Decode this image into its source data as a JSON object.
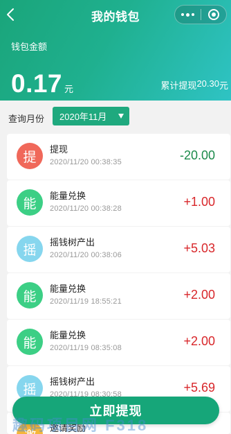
{
  "nav": {
    "title": "我的钱包",
    "back_icon": "chevron-left-icon",
    "more_icon": "more-dots-icon",
    "close_icon": "target-circle-icon"
  },
  "header": {
    "wallet_label": "钱包金额",
    "balance": "0.17",
    "balance_unit": "元",
    "total_withdraw_label": "累计提现",
    "total_withdraw_value": "20.30",
    "total_withdraw_unit": "元"
  },
  "filter": {
    "label": "查询月份",
    "month": "2020年11月"
  },
  "records": [
    {
      "icon_char": "提",
      "icon_color": "#f0685a",
      "title": "提现",
      "time": "2020/11/20 00:38:35",
      "amount": "-20.00",
      "amount_color": "#1b8a4a"
    },
    {
      "icon_char": "能",
      "icon_color": "#3ccf85",
      "title": "能量兑换",
      "time": "2020/11/20 00:38:28",
      "amount": "+1.00",
      "amount_color": "#d8262a"
    },
    {
      "icon_char": "摇",
      "icon_color": "#86d6ee",
      "title": "摇钱树产出",
      "time": "2020/11/20 00:38:06",
      "amount": "+5.03",
      "amount_color": "#d8262a"
    },
    {
      "icon_char": "能",
      "icon_color": "#3ccf85",
      "title": "能量兑换",
      "time": "2020/11/19 18:55:21",
      "amount": "+2.00",
      "amount_color": "#d8262a"
    },
    {
      "icon_char": "能",
      "icon_color": "#3ccf85",
      "title": "能量兑换",
      "time": "2020/11/19 08:35:08",
      "amount": "+2.00",
      "amount_color": "#d8262a"
    },
    {
      "icon_char": "摇",
      "icon_color": "#86d6ee",
      "title": "摇钱树产出",
      "time": "2020/11/19 08:30:58",
      "amount": "+5.69",
      "amount_color": "#d8262a"
    },
    {
      "icon_char": "邀",
      "icon_color": "#f5b63a",
      "title": "邀请奖励",
      "time": "",
      "amount": "",
      "amount_color": "#d8262a"
    }
  ],
  "bottom_button": "立即提现",
  "watermark": "趣码项目网 F318"
}
